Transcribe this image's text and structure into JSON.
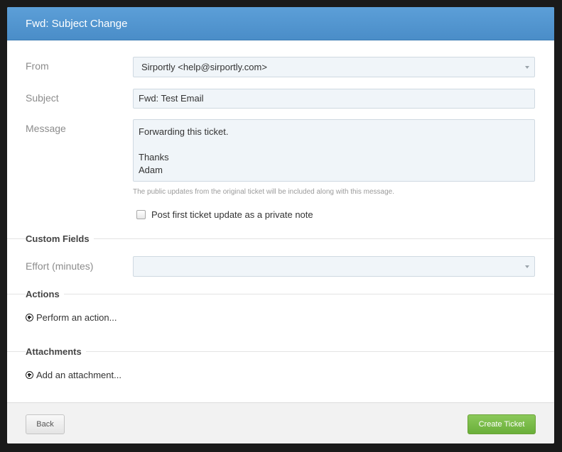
{
  "dialog": {
    "title": "Fwd: Subject Change"
  },
  "form": {
    "from_label": "From",
    "from_value": "Sirportly <help@sirportly.com>",
    "subject_label": "Subject",
    "subject_value": "Fwd: Test Email",
    "message_label": "Message",
    "message_lines": [
      "Forwarding this ticket.",
      "",
      "Thanks",
      "Adam"
    ],
    "message_hint": "The public updates from the original ticket will be included along with this message.",
    "private_note_label": "Post first ticket update as a private note",
    "private_note_checked": false
  },
  "custom_fields": {
    "title": "Custom Fields",
    "effort_label": "Effort (minutes)",
    "effort_value": ""
  },
  "actions": {
    "title": "Actions",
    "link_label": "Perform an action..."
  },
  "attachments": {
    "title": "Attachments",
    "link_label": "Add an attachment..."
  },
  "footer": {
    "back_label": "Back",
    "create_label": "Create Ticket"
  },
  "icons": {
    "plus": "plus-circle-icon",
    "caret": "caret-down-icon"
  },
  "colors": {
    "titlebar": "#5294cf",
    "primary_button": "#7bbd4a"
  }
}
